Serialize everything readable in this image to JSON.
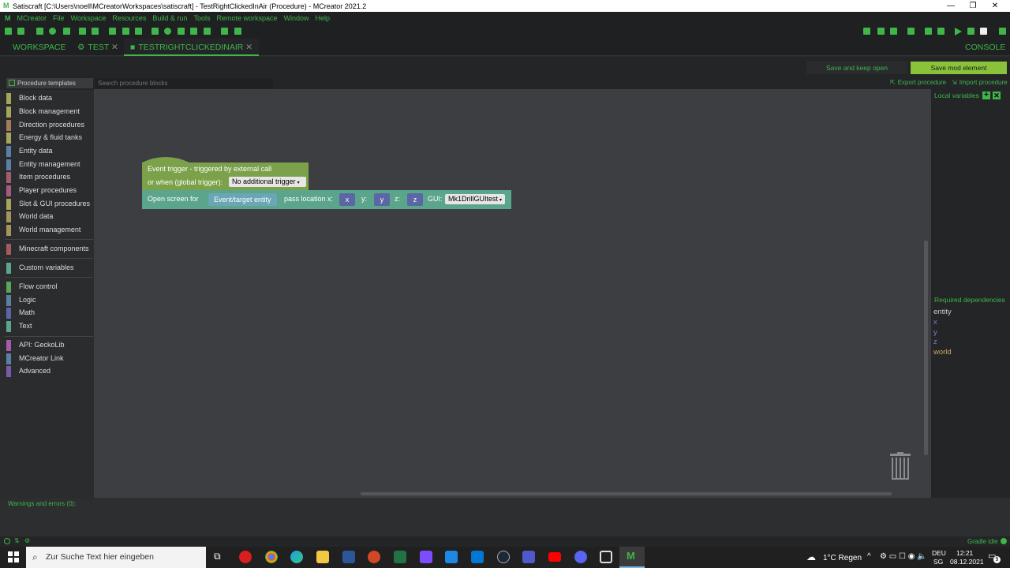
{
  "window": {
    "title": "Satiscraft [C:\\Users\\noell\\MCreatorWorkspaces\\satiscraft] - TestRightClickedInAir (Procedure) - MCreator 2021.2"
  },
  "menu": [
    "MCreator",
    "File",
    "Workspace",
    "Resources",
    "Build & run",
    "Tools",
    "Remote workspace",
    "Window",
    "Help"
  ],
  "tabs": {
    "workspace": "WORKSPACE",
    "test": "TEST",
    "current": "TESTRIGHTCLICKEDINAIR",
    "console": "CONSOLE"
  },
  "actions": {
    "save_keep_open": "Save and keep open",
    "save_mod": "Save mod element",
    "export": "Export procedure",
    "import": "Import procedure"
  },
  "palette": {
    "templates": "Procedure templates",
    "search_placeholder": "Search procedure blocks",
    "categories": [
      {
        "label": "Block data",
        "color": "#a5a55b"
      },
      {
        "label": "Block management",
        "color": "#a5a55b"
      },
      {
        "label": "Direction procedures",
        "color": "#a57b5b"
      },
      {
        "label": "Energy & fluid tanks",
        "color": "#a5a55b"
      },
      {
        "label": "Entity data",
        "color": "#5b80a5"
      },
      {
        "label": "Entity management",
        "color": "#5b80a5"
      },
      {
        "label": "Item procedures",
        "color": "#a55b6d"
      },
      {
        "label": "Player procedures",
        "color": "#a55b80"
      },
      {
        "label": "Slot & GUI procedures",
        "color": "#a5a55b"
      },
      {
        "label": "World data",
        "color": "#a5945b"
      },
      {
        "label": "World management",
        "color": "#a5945b"
      },
      {
        "label": "Minecraft components",
        "color": "#a55b5b"
      },
      {
        "label": "Custom variables",
        "color": "#5ba58c"
      },
      {
        "label": "Flow control",
        "color": "#5ba55b"
      },
      {
        "label": "Logic",
        "color": "#5b80a5"
      },
      {
        "label": "Math",
        "color": "#5b67a5"
      },
      {
        "label": "Text",
        "color": "#5ba58c"
      },
      {
        "label": "API: GeckoLib",
        "color": "#a55ba5"
      },
      {
        "label": "MCreator Link",
        "color": "#5b80a5"
      },
      {
        "label": "Advanced",
        "color": "#7b5ba5"
      }
    ]
  },
  "blocks": {
    "trigger_line1": "Event trigger - triggered by external call",
    "trigger_line2": "or when (global trigger):",
    "trigger_value": "No additional trigger",
    "open_screen": "Open screen for",
    "entity": "Event/target entity",
    "pass_loc": "pass location x:",
    "x": "x",
    "y_label": "y:",
    "y": "y",
    "z_label": "z:",
    "z": "z",
    "gui_label": "GUI:",
    "gui_value": "Mk1DrillGUItest"
  },
  "right": {
    "local_vars": "Local variables",
    "req_deps": "Required dependencies",
    "deps": [
      {
        "name": "entity",
        "color": "#cccccc"
      },
      {
        "name": "x",
        "color": "#8a7ad0"
      },
      {
        "name": "y",
        "color": "#8a7ad0"
      },
      {
        "name": "z",
        "color": "#8a7ad0"
      },
      {
        "name": "world",
        "color": "#c8a96a"
      }
    ]
  },
  "warnings": "Warnings and errors (0):",
  "status": "Gradle idle",
  "taskbar": {
    "search": "Zur Suche Text hier eingeben",
    "weather": "1°C  Regen",
    "lang1": "DEU",
    "lang2": "SG",
    "time": "12:21",
    "date": "08.12.2021",
    "notif": "9"
  }
}
